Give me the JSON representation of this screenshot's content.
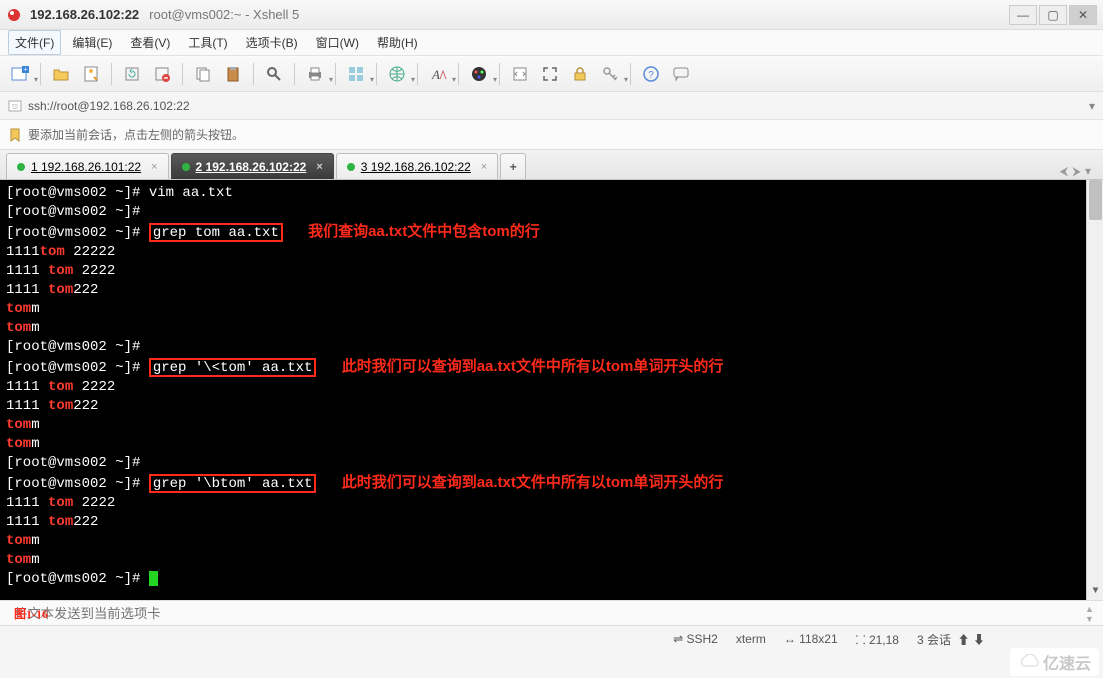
{
  "titlebar": {
    "host": "192.168.26.102:22",
    "session": "root@vms002:~ - Xshell 5"
  },
  "menu": {
    "file": "文件(F)",
    "edit": "编辑(E)",
    "view": "查看(V)",
    "tools": "工具(T)",
    "tabs": "选项卡(B)",
    "window": "窗口(W)",
    "help": "帮助(H)"
  },
  "addressbar": {
    "url": "ssh://root@192.168.26.102:22"
  },
  "hintbar": {
    "text": "要添加当前会话，点击左侧的箭头按钮。"
  },
  "tabs": [
    {
      "label": "1 192.168.26.101:22",
      "active": false
    },
    {
      "label": "2 192.168.26.102:22",
      "active": true
    },
    {
      "label": "3 192.168.26.102:22",
      "active": false
    }
  ],
  "terminal": {
    "prompt": "[root@vms002 ~]#",
    "cmd_vim": "vim aa.txt",
    "cmd_grep1": "grep tom aa.txt",
    "annot1": "我们查询aa.txt文件中包含tom的行",
    "cmd_grep2": "grep '\\<tom' aa.txt",
    "annot2": "此时我们可以查询到aa.txt文件中所有以tom单词开头的行",
    "cmd_grep3": "grep '\\btom' aa.txt",
    "annot3": "此时我们可以查询到aa.txt文件中所有以tom单词开头的行",
    "out": {
      "l1_a": "1111",
      "l1_m": "tom",
      "l1_b": " 22222",
      "l2_a": "1111 ",
      "l2_m": "tom",
      "l2_b": " 2222",
      "l3_a": "1111 ",
      "l3_m": "tom",
      "l3_b": "222",
      "l4_m": "tom",
      "l4_b": "m",
      "l5_m": "tom",
      "l5_b": "m"
    }
  },
  "inputbar": {
    "placeholder": "将文本发送到当前选项卡",
    "figlabel": "图1-16"
  },
  "statusbar": {
    "proto": "SSH2",
    "term": "xterm",
    "size": "118x21",
    "pos": "21,18",
    "sess": "3 会话"
  },
  "logo": {
    "text": "亿速云"
  },
  "icons": {
    "arrow_dd": "▾",
    "plus": "+",
    "left": "⮜",
    "right": "⮞",
    "down": "▾"
  }
}
